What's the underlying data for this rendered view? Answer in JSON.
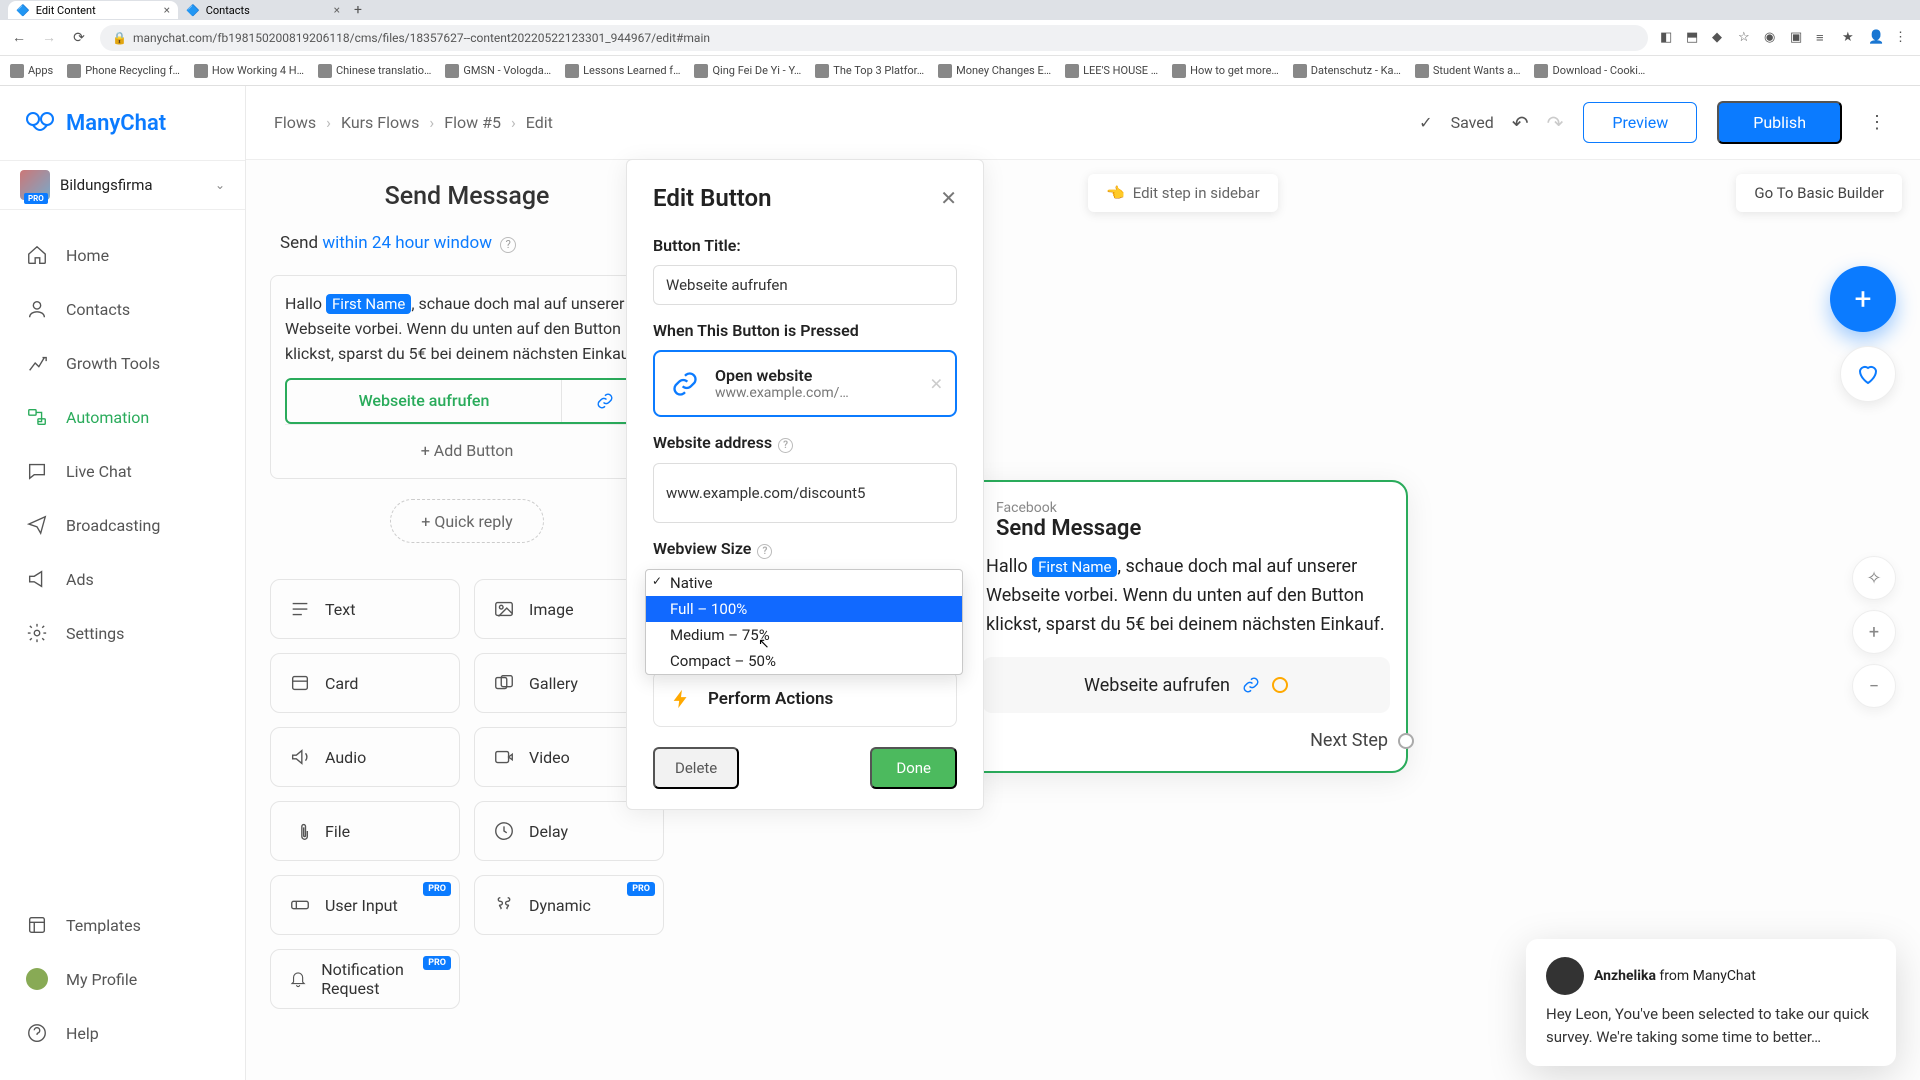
{
  "browser": {
    "tabs": [
      {
        "title": "Edit Content",
        "active": true
      },
      {
        "title": "Contacts",
        "active": false
      }
    ],
    "url": "manychat.com/fb198150200819206118/cms/files/18357627--content20220522123301_944967/edit#main",
    "bookmarks": [
      "Apps",
      "Phone Recycling f…",
      "How Working 4 H…",
      "Chinese translatio…",
      "GMSN - Vologda…",
      "Lessons Learned f…",
      "Qing Fei De Yi - Y…",
      "The Top 3 Platfor…",
      "Money Changes E…",
      "LEE'S HOUSE …",
      "How to get more…",
      "Datenschutz - Ka…",
      "Student Wants a…",
      "Download - Cooki…"
    ]
  },
  "app": {
    "brand": "ManyChat",
    "workspace": {
      "name": "Bildungsfirma",
      "badge": "PRO"
    },
    "nav": [
      {
        "key": "home",
        "label": "Home"
      },
      {
        "key": "contacts",
        "label": "Contacts"
      },
      {
        "key": "growth",
        "label": "Growth Tools"
      },
      {
        "key": "automation",
        "label": "Automation",
        "active": true
      },
      {
        "key": "livechat",
        "label": "Live Chat"
      },
      {
        "key": "broadcasting",
        "label": "Broadcasting"
      },
      {
        "key": "ads",
        "label": "Ads"
      },
      {
        "key": "settings",
        "label": "Settings"
      }
    ],
    "nav_bottom": [
      {
        "key": "templates",
        "label": "Templates"
      },
      {
        "key": "profile",
        "label": "My Profile"
      },
      {
        "key": "help",
        "label": "Help"
      }
    ]
  },
  "topbar": {
    "crumbs": [
      "Flows",
      "Kurs Flows",
      "Flow #5",
      "Edit"
    ],
    "saved": "Saved",
    "preview": "Preview",
    "publish": "Publish"
  },
  "canvas": {
    "edit_pill": "Edit step in sidebar",
    "goto_basic": "Go To Basic Builder"
  },
  "send_panel": {
    "title": "Send Message",
    "sub_prefix": "Send ",
    "sub_link": "within 24 hour window",
    "msg_prefix": "Hallo ",
    "msg_chip": "First Name",
    "msg_rest": ", schaue doch mal auf unserer Webseite vorbei. Wenn du unten auf den Button klickst, sparst du 5€ bei deinem nächsten Einkauf.",
    "msg_button": "Webseite aufrufen",
    "add_button": "+ Add Button",
    "quick_reply": "+ Quick reply",
    "blocks": [
      {
        "key": "text",
        "label": "Text"
      },
      {
        "key": "image",
        "label": "Image"
      },
      {
        "key": "card",
        "label": "Card"
      },
      {
        "key": "gallery",
        "label": "Gallery"
      },
      {
        "key": "audio",
        "label": "Audio"
      },
      {
        "key": "video",
        "label": "Video"
      },
      {
        "key": "file",
        "label": "File"
      },
      {
        "key": "delay",
        "label": "Delay"
      },
      {
        "key": "userinput",
        "label": "User Input",
        "pro": true
      },
      {
        "key": "dynamic",
        "label": "Dynamic",
        "pro": true
      },
      {
        "key": "notif",
        "label": "Notification Request",
        "pro": true
      }
    ],
    "pro_badge": "PRO"
  },
  "modal": {
    "title": "Edit Button",
    "label_title": "Button Title:",
    "value_title": "Webseite aufrufen",
    "label_when": "When This Button is Pressed",
    "action_title": "Open website",
    "action_sub": "www.example.com/…",
    "label_addr": "Website address",
    "value_addr": "www.example.com/discount5",
    "label_size": "Webview Size",
    "dd": {
      "selected": "Native",
      "items": [
        "Native",
        "Full – 100%",
        "Medium – 75%",
        "Compact – 50%"
      ],
      "highlight_index": 1
    },
    "perform": "Perform Actions",
    "delete": "Delete",
    "done": "Done"
  },
  "node": {
    "platform": "Facebook",
    "title": "Send Message",
    "msg_prefix": "Hallo ",
    "msg_chip": "First Name",
    "msg_rest": ", schaue doch mal auf unserer Webseite vorbei. Wenn du unten auf den Button klickst, sparst du 5€ bei deinem nächsten Einkauf.",
    "button": "Webseite aufrufen",
    "next": "Next Step"
  },
  "chat": {
    "name": "Anzhelika",
    "from": " from ManyChat",
    "body": "Hey Leon,  You've been selected to take our quick survey. We're taking some time to better…"
  }
}
